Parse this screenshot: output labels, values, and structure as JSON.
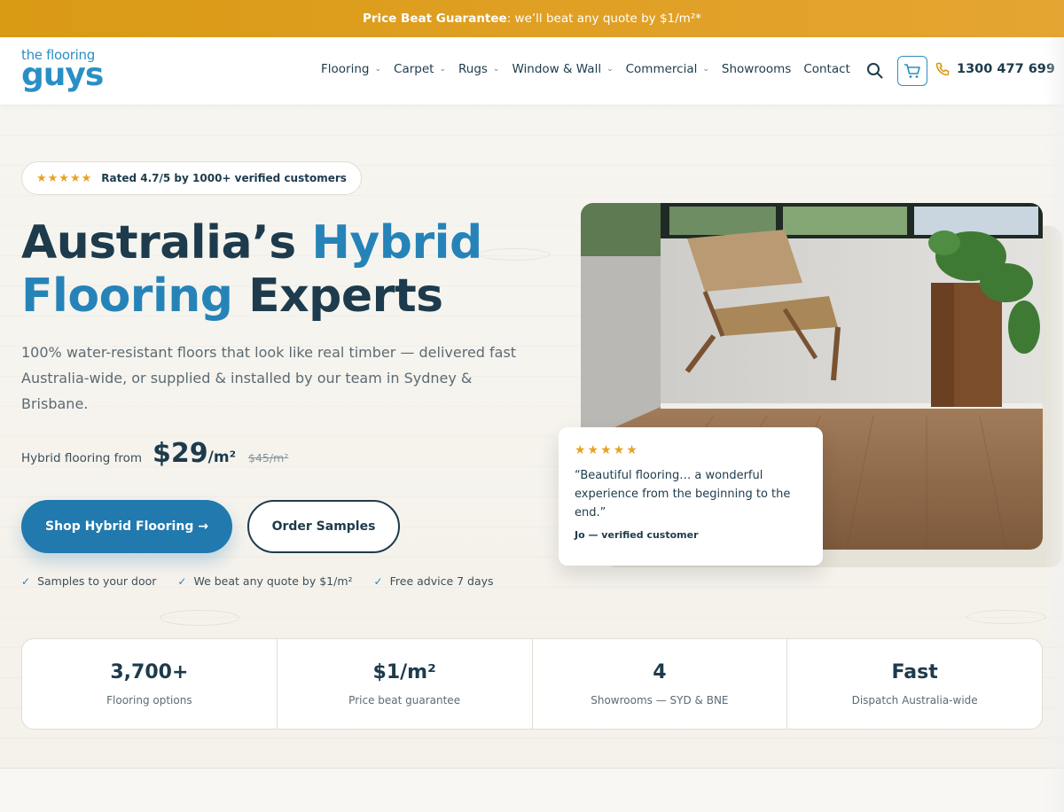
{
  "announcement": {
    "bold": "Price Beat Guarantee",
    "rest": ": we’ll beat any quote by $1/m²*"
  },
  "logo": {
    "line1": "the flooring",
    "line2": "guys"
  },
  "nav": {
    "items": [
      {
        "label": "Flooring",
        "dropdown": true
      },
      {
        "label": "Carpet",
        "dropdown": true
      },
      {
        "label": "Rugs",
        "dropdown": true
      },
      {
        "label": "Window & Wall",
        "dropdown": true
      },
      {
        "label": "Commercial",
        "dropdown": true
      },
      {
        "label": "Showrooms",
        "dropdown": false
      },
      {
        "label": "Contact",
        "dropdown": false
      }
    ],
    "phone": "1300 477 699",
    "icons": [
      "search-icon",
      "cart-icon",
      "phone-icon"
    ]
  },
  "hero": {
    "rating_stars": "★★★★★",
    "rating_text": "Rated 4.7/5 by 1000+ verified customers",
    "title_part1": "Australia’s ",
    "title_accent1": "Hybrid",
    "title_accent2": "Flooring",
    "title_part2": " Experts",
    "subtitle": "100% water-resistant floors that look like real timber — delivered fast Australia-wide, or supplied & installed by our team in Sydney & Brisbane.",
    "price_label": "Hybrid flooring from",
    "price_now": "$29",
    "price_unit": "/m²",
    "price_old": "$45/m²",
    "cta_primary": "Shop Hybrid Flooring →",
    "cta_secondary": "Order Samples",
    "perks": [
      "Samples to your door",
      "We beat any quote by $1/m²",
      "Free advice 7 days"
    ]
  },
  "review": {
    "stars": "★★★★★",
    "text": "“Beautiful flooring… a wonderful experience from the beginning to the end.”",
    "author": "Jo — verified customer"
  },
  "stats": [
    {
      "value": "3,700+",
      "label": "Flooring options"
    },
    {
      "value": "$1/m²",
      "label": "Price beat guarantee"
    },
    {
      "value": "4",
      "label": "Showrooms — SYD & BNE"
    },
    {
      "value": "Fast",
      "label": "Dispatch Australia-wide"
    }
  ],
  "colors": {
    "brand_blue": "#2683b8",
    "navy": "#1d3b4c",
    "gold": "#e0a12a",
    "star": "#e9a21f"
  }
}
